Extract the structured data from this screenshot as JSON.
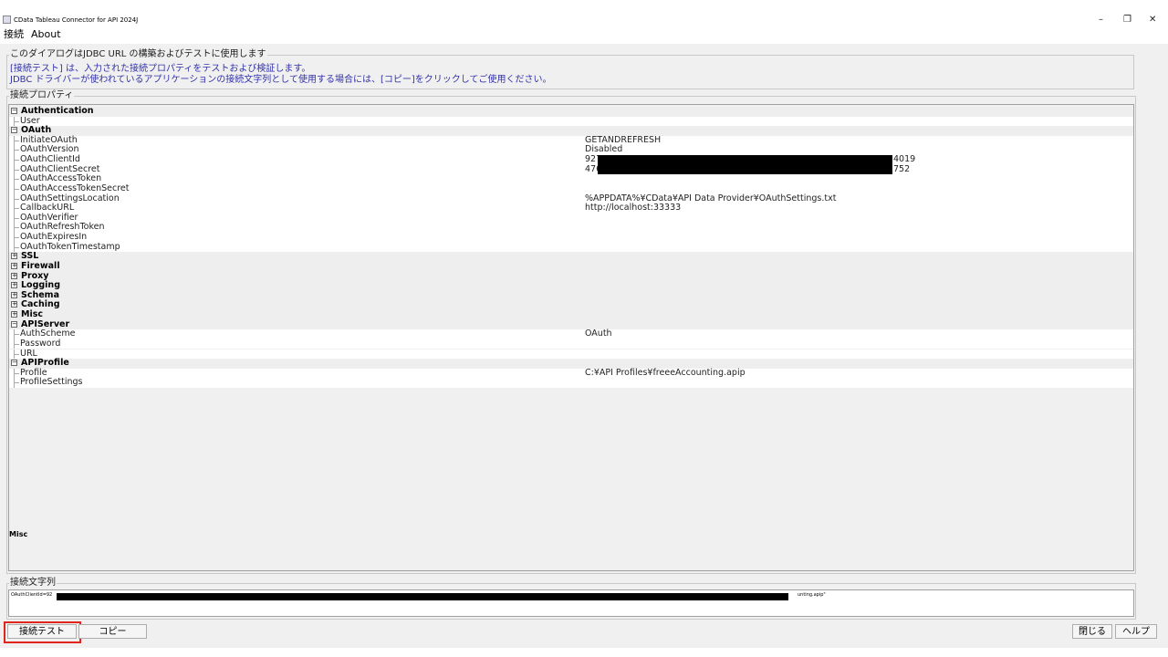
{
  "window": {
    "title": "CData Tableau Connector for API 2024J",
    "controls": [
      "–",
      "❐",
      "✕"
    ]
  },
  "menu": [
    "接続",
    "About"
  ],
  "description": {
    "legend": "このダイアログはJDBC URL の構築およびテストに使用します",
    "lines": [
      "[接続テスト] は、入力された接続プロパティをテストおよび検証します。",
      "JDBC ドライバーが使われているアプリケーションの接続文字列として使用する場合には、[コピー]をクリックしてご使用ください。"
    ]
  },
  "properties_legend": "接続プロパティ",
  "grid_rows": [
    {
      "type": "cat",
      "expanded": true,
      "name": "Authentication"
    },
    {
      "type": "prop",
      "name": "User",
      "value": ""
    },
    {
      "type": "cat",
      "expanded": true,
      "name": "OAuth"
    },
    {
      "type": "prop",
      "name": "InitiateOAuth",
      "value": "GETANDREFRESH"
    },
    {
      "type": "prop",
      "name": "OAuthVersion",
      "value": "Disabled"
    },
    {
      "type": "prop",
      "name": "OAuthClientId",
      "value": "927",
      "suffix": "4019"
    },
    {
      "type": "prop",
      "name": "OAuthClientSecret",
      "value": "476",
      "suffix": "752"
    },
    {
      "type": "prop",
      "name": "OAuthAccessToken",
      "value": ""
    },
    {
      "type": "prop",
      "name": "OAuthAccessTokenSecret",
      "value": ""
    },
    {
      "type": "prop",
      "name": "OAuthSettingsLocation",
      "value": "%APPDATA%¥CData¥API Data Provider¥OAuthSettings.txt"
    },
    {
      "type": "prop",
      "name": "CallbackURL",
      "value": "http://localhost:33333"
    },
    {
      "type": "prop",
      "name": "OAuthVerifier",
      "value": ""
    },
    {
      "type": "prop",
      "name": "OAuthRefreshToken",
      "value": ""
    },
    {
      "type": "prop",
      "name": "OAuthExpiresIn",
      "value": ""
    },
    {
      "type": "prop",
      "name": "OAuthTokenTimestamp",
      "value": ""
    },
    {
      "type": "cat",
      "expanded": false,
      "name": "SSL"
    },
    {
      "type": "cat",
      "expanded": false,
      "name": "Firewall"
    },
    {
      "type": "cat",
      "expanded": false,
      "name": "Proxy"
    },
    {
      "type": "cat",
      "expanded": false,
      "name": "Logging"
    },
    {
      "type": "cat",
      "expanded": false,
      "name": "Schema"
    },
    {
      "type": "cat",
      "expanded": false,
      "name": "Caching"
    },
    {
      "type": "cat",
      "expanded": false,
      "name": "Misc"
    },
    {
      "type": "cat",
      "expanded": true,
      "name": "APIServer"
    },
    {
      "type": "prop",
      "name": "AuthScheme",
      "value": "OAuth"
    },
    {
      "type": "prop",
      "name": "Password",
      "value": ""
    },
    {
      "type": "prop",
      "name": "URL",
      "value": ""
    },
    {
      "type": "cat",
      "expanded": true,
      "name": "APIProfile"
    },
    {
      "type": "prop",
      "name": "Profile",
      "value": "C:¥API Profiles¥freeeAccounting.apip"
    },
    {
      "type": "prop",
      "name": "ProfileSettings",
      "value": ""
    }
  ],
  "misc_label": "Misc",
  "connection_string": {
    "legend": "接続文字列",
    "prefix": "OAuthClientId=92",
    "suffix": "unting.apip\""
  },
  "buttons": {
    "test": "接続テスト",
    "copy": "コピー",
    "close": "閉じる",
    "help": "ヘルプ"
  },
  "colors": {
    "description_text": "#3333aa",
    "highlight": "#e0261c",
    "redaction": "#000000"
  }
}
